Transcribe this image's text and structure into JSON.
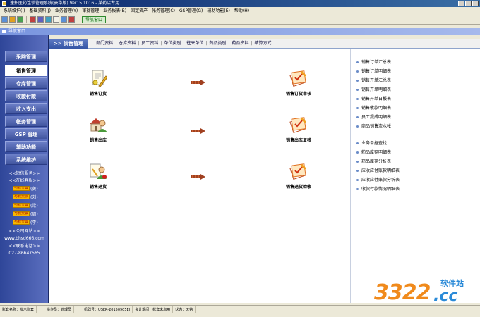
{
  "window": {
    "title": "速拓医药连锁管理系统(豪华版) Ver15.1016 - 某药店专用"
  },
  "menubar": [
    "系统维护(I)",
    "基础资料(J)",
    "业务管理(Y)",
    "审批管理",
    "业务报表(B)",
    "固定资产",
    "帐务管理(C)",
    "GSP管理(G)",
    "辅助功能(E)",
    "帮助(H)"
  ],
  "toolbar": {
    "quick_label": "导航窗口"
  },
  "child_window": {
    "title": "导航窗口"
  },
  "sidebar": {
    "items": [
      "采购管理",
      "销售管理",
      "仓库管理",
      "收款付款",
      "收入支出",
      "帐务管理",
      "GSP 管理",
      "辅助功能",
      "系统维护"
    ],
    "active": "销售管理",
    "sms_service": "<<短信服务>>",
    "online_support": "<<在线客服>>",
    "qq_list": [
      {
        "badge": "与我交谈",
        "name": "(黄)"
      },
      {
        "badge": "与我交谈",
        "name": "(刘)"
      },
      {
        "badge": "与我交谈",
        "name": "(梁)"
      },
      {
        "badge": "与我交谈",
        "name": "(周)"
      },
      {
        "badge": "与我交谈",
        "name": "(李)"
      }
    ],
    "website_label": "<<公司网站>>",
    "website": "www.bhsd666.com",
    "phone_label": "<<联系电话>>",
    "phone": "027-86647565"
  },
  "tabs": {
    "active": ">> 销售管理",
    "items": [
      "部门资料",
      "仓库资料",
      "员工资料",
      "单位类别",
      "往来单位",
      "药品类别",
      "药品资料",
      "结算方式"
    ]
  },
  "flow": {
    "nodes": [
      {
        "label": "销售订货",
        "icon": "document-pen-icon"
      },
      {
        "label": "销售订货审核",
        "icon": "clipboard-check-icon"
      },
      {
        "label": "销售出库",
        "icon": "warehouse-person-icon"
      },
      {
        "label": "销售出库复核",
        "icon": "clipboard-check-icon"
      },
      {
        "label": "销售退货",
        "icon": "return-person-icon"
      },
      {
        "label": "销售退货验收",
        "icon": "clipboard-check-icon"
      }
    ]
  },
  "reports_group1": [
    "销售订单汇总表",
    "销售订单明细表",
    "销售开单汇总表",
    "销售开单明细表",
    "销售开单日报表",
    "销售收款明细表",
    "员工提成明细表",
    "商品销售流水帐"
  ],
  "reports_group2": [
    "业务单据查找",
    "药品库存明细表",
    "药品库存分析表",
    "应收应付账款明细表",
    "应收应付账款分析表",
    "收款付款情况明细表"
  ],
  "statusbar": {
    "account": "账套名称：演示账套",
    "operator": "操作员：管理员",
    "machine": "机器号：USER-20150905EI",
    "period": "会计期间：帐套未启用",
    "state": "状态：无钩"
  },
  "watermark": {
    "number": "3322",
    "suffix": ".cc",
    "zh": "软件站"
  },
  "colors": {
    "sidebar": "#3e56a8",
    "accent_tab": "#3556a6",
    "watermark_orange": "#f08a1c",
    "watermark_blue": "#2a8ad8"
  }
}
